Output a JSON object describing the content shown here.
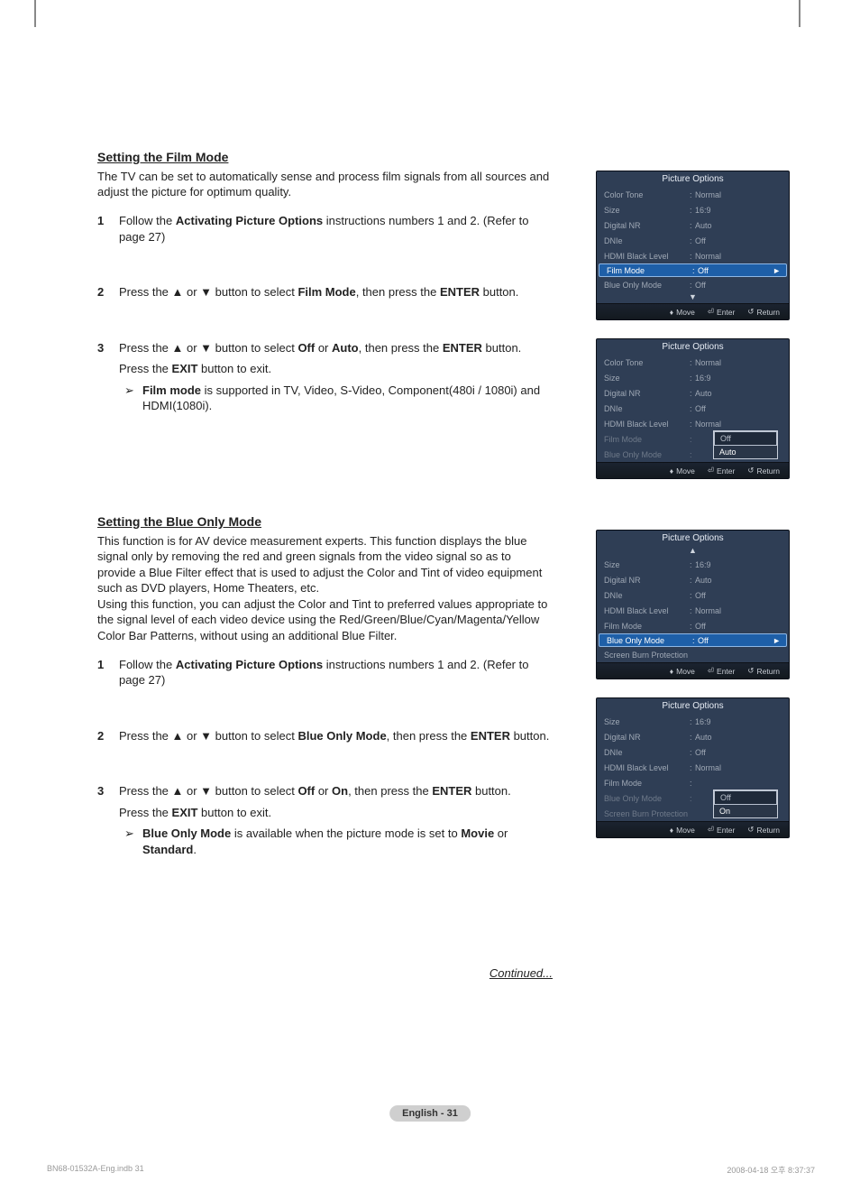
{
  "sectionA": {
    "title": "Setting the Film Mode",
    "intro": "The TV can be set to automatically sense and process film signals from all sources and adjust the picture for optimum quality.",
    "step1a": "Follow the ",
    "step1b": "Activating Picture Options",
    "step1c": " instructions numbers 1 and 2. (Refer to page 27)",
    "step2a": "Press the ▲ or ▼ button to select ",
    "step2b": "Film Mode",
    "step2c": ", then press the ",
    "step2d": "ENTER",
    "step2e": " button.",
    "step3a": "Press the ▲ or ▼ button to select ",
    "step3b": "Off",
    "step3c": " or ",
    "step3d": "Auto",
    "step3e": ", then press the ",
    "step3f": "ENTER",
    "step3g": " button.",
    "step3exitA": "Press the ",
    "step3exitB": "EXIT",
    "step3exitC": " button to exit.",
    "noteA": "Film mode",
    "noteB": " is supported in TV, Video, S-Video, Component(480i / 1080i) and HDMI(1080i)."
  },
  "sectionB": {
    "title": "Setting the Blue Only Mode",
    "intro1": "This function is for AV device measurement experts. This function displays the blue signal only by removing the red and green signals from the video signal so as to provide a Blue Filter effect that is used to adjust the Color and Tint of video equipment such as DVD players, Home Theaters, etc.",
    "intro2": "Using this function, you can adjust the Color and Tint to preferred values appropriate to the signal level of each video device using the Red/Green/Blue/Cyan/Magenta/Yellow Color Bar Patterns, without using an additional Blue Filter.",
    "step1a": "Follow the ",
    "step1b": "Activating Picture Options",
    "step1c": " instructions numbers 1 and 2. (Refer to page 27)",
    "step2a": "Press the ▲ or ▼ button to select ",
    "step2b": "Blue Only Mode",
    "step2c": ", then press the ",
    "step2d": "ENTER",
    "step2e": " button.",
    "step3a": "Press the ▲ or ▼ button to select ",
    "step3b": "Off",
    "step3c": " or ",
    "step3d": "On",
    "step3e": ", then press the ",
    "step3f": "ENTER",
    "step3g": " button.",
    "step3exitA": "Press the ",
    "step3exitB": "EXIT",
    "step3exitC": " button to exit.",
    "noteA": "Blue Only Mode",
    "noteB": " is available when the picture mode is set to ",
    "noteC": "Movie",
    "noteD": " or ",
    "noteE": "Standard",
    "noteF": "."
  },
  "continued": "Continued...",
  "osdTitle": "Picture Options",
  "footer": {
    "move": "Move",
    "enter": "Enter",
    "return": "Return"
  },
  "osd1": {
    "rows": [
      {
        "label": "Color Tone",
        "value": "Normal"
      },
      {
        "label": "Size",
        "value": "16:9"
      },
      {
        "label": "Digital NR",
        "value": "Auto"
      },
      {
        "label": "DNIe",
        "value": "Off"
      },
      {
        "label": "HDMI Black Level",
        "value": "Normal"
      },
      {
        "label": "Film Mode",
        "value": "Off",
        "hl": true
      },
      {
        "label": "Blue Only Mode",
        "value": "Off"
      }
    ]
  },
  "osd2": {
    "rows": [
      {
        "label": "Color Tone",
        "value": "Normal"
      },
      {
        "label": "Size",
        "value": "16:9"
      },
      {
        "label": "Digital NR",
        "value": "Auto"
      },
      {
        "label": "DNIe",
        "value": "Off"
      },
      {
        "label": "HDMI Black Level",
        "value": "Normal"
      },
      {
        "label": "Film Mode",
        "value": ""
      },
      {
        "label": "Blue Only Mode",
        "value": ""
      }
    ],
    "popup": [
      "Off",
      "Auto"
    ]
  },
  "osd3": {
    "rows": [
      {
        "label": "Size",
        "value": "16:9"
      },
      {
        "label": "Digital NR",
        "value": "Auto"
      },
      {
        "label": "DNIe",
        "value": "Off"
      },
      {
        "label": "HDMI Black Level",
        "value": "Normal"
      },
      {
        "label": "Film Mode",
        "value": "Off"
      },
      {
        "label": "Blue Only Mode",
        "value": "Off",
        "hl": true
      },
      {
        "label": "Screen Burn Protection",
        "value": ""
      }
    ]
  },
  "osd4": {
    "rows": [
      {
        "label": "Size",
        "value": "16:9"
      },
      {
        "label": "Digital NR",
        "value": "Auto"
      },
      {
        "label": "DNIe",
        "value": "Off"
      },
      {
        "label": "HDMI Black Level",
        "value": "Normal"
      },
      {
        "label": "Film Mode",
        "value": ""
      },
      {
        "label": "Blue Only Mode",
        "value": ""
      },
      {
        "label": "Screen Burn Protection",
        "value": ""
      }
    ],
    "popup": [
      "Off",
      "On"
    ]
  },
  "pageFooter": "English - 31",
  "imprint": {
    "left": "BN68-01532A-Eng.indb   31",
    "right": "2008-04-18   오후 8:37:37"
  }
}
